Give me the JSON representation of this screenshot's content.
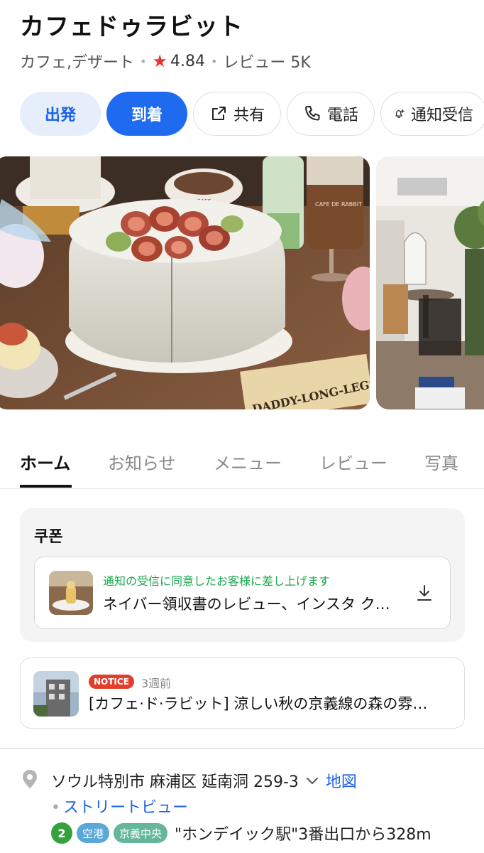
{
  "place": {
    "name": "カフェドゥラビット",
    "category": "カフェ,デザート",
    "rating": "4.84",
    "reviews": "レビュー 5K"
  },
  "actions": {
    "depart": "出発",
    "arrive": "到着",
    "share": "共有",
    "call": "電話",
    "notify": "通知受信"
  },
  "photos": {
    "main_book_text": "DADDY-LONG-LEGS",
    "main_cup_text": "CAFE",
    "main_glass_text": "CAFE DE RABBIT"
  },
  "tabs": [
    "ホーム",
    "お知らせ",
    "メニュー",
    "レビュー",
    "写真"
  ],
  "coupon": {
    "title": "쿠폰",
    "green_text": "通知の受信に同意したお客様に差し上げます",
    "main_text": "ネイバー領収書のレビュー、インスタ ク…"
  },
  "notice": {
    "badge": "NOTICE",
    "time": "3週前",
    "text": "[カフェ·ド·ラビット] 涼しい秋の京義線の森の雰…"
  },
  "address": {
    "text": "ソウル特別市 麻浦区 延南洞 259-3",
    "map_link": "地図",
    "street_view": "ストリートビュー",
    "line_number": "2",
    "tag_airport": "空港",
    "tag_gyeongui": "京義中央",
    "directions": "\"ホンデイック駅\"3番出口から328m"
  },
  "colors": {
    "accent_blue": "#1e6bf0",
    "star_red": "#e8352b",
    "green_text": "#19a74b",
    "notice_red": "#e23d2d"
  }
}
